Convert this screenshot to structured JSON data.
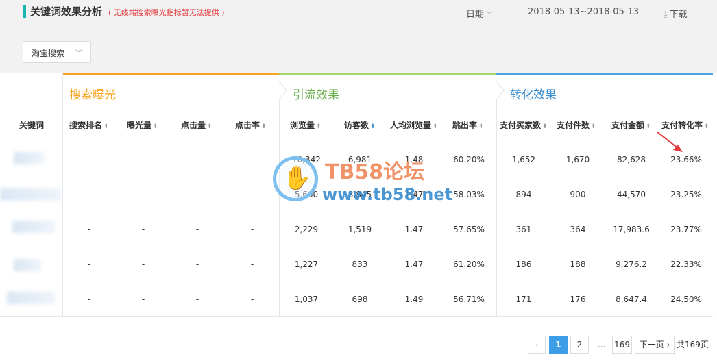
{
  "header": {
    "title": "关键词效果分析",
    "note": "( 无线端搜索曝光指标暂无法提供 )",
    "date_label": "日期",
    "date_range": "2018-05-13~2018-05-13",
    "download_label": "下载"
  },
  "filter": {
    "source_select": "淘宝搜索"
  },
  "groups": {
    "search": "搜索曝光",
    "traffic": "引流效果",
    "conversion": "转化效果"
  },
  "columns": {
    "keyword": "关键词",
    "search_rank": "搜索排名",
    "impressions": "曝光量",
    "clicks": "点击量",
    "ctr": "点击率",
    "pageviews": "浏览量",
    "visitors": "访客数",
    "pv_per_visitor": "人均浏览量",
    "bounce_rate": "跳出率",
    "buyers": "支付买家数",
    "items": "支付件数",
    "amount": "支付金额",
    "conv_rate": "支付转化率"
  },
  "rows": [
    {
      "rank": "-",
      "imp": "-",
      "clk": "-",
      "ctr": "-",
      "pv": "10,342",
      "uv": "6,981",
      "ppv": "1.48",
      "bounce": "60.20%",
      "buyers": "1,652",
      "items": "1,670",
      "amount": "82,628",
      "conv": "23.66%"
    },
    {
      "rank": "-",
      "imp": "-",
      "clk": "-",
      "ctr": "-",
      "pv": "5,660",
      "uv": "3,845",
      "ppv": "1.47",
      "bounce": "58.03%",
      "buyers": "894",
      "items": "900",
      "amount": "44,570",
      "conv": "23.25%"
    },
    {
      "rank": "-",
      "imp": "-",
      "clk": "-",
      "ctr": "-",
      "pv": "2,229",
      "uv": "1,519",
      "ppv": "1.47",
      "bounce": "57.65%",
      "buyers": "361",
      "items": "364",
      "amount": "17,983.6",
      "conv": "23.77%"
    },
    {
      "rank": "-",
      "imp": "-",
      "clk": "-",
      "ctr": "-",
      "pv": "1,227",
      "uv": "833",
      "ppv": "1.47",
      "bounce": "61.20%",
      "buyers": "186",
      "items": "188",
      "amount": "9,276.2",
      "conv": "22.33%"
    },
    {
      "rank": "-",
      "imp": "-",
      "clk": "-",
      "ctr": "-",
      "pv": "1,037",
      "uv": "698",
      "ppv": "1.49",
      "bounce": "56.71%",
      "buyers": "171",
      "items": "176",
      "amount": "8,647.4",
      "conv": "24.50%"
    }
  ],
  "watermark": {
    "title": "TB58论坛",
    "url": "www.tb58.net"
  },
  "pagination": {
    "prev": "‹",
    "pages": [
      "1",
      "2"
    ],
    "ellipsis": "...",
    "last": "169",
    "next": "下一页",
    "total": "共169页",
    "current": "1"
  },
  "colors": {
    "accent": "#3b9ee6",
    "search_group": "#f5a623",
    "traffic_group": "#a6d96a",
    "conversion_group": "#4aa3df",
    "note_red": "#e4393c"
  },
  "icons": [
    "chevron-down-icon",
    "download-icon",
    "sort-icon",
    "red-arrow-annotation"
  ]
}
